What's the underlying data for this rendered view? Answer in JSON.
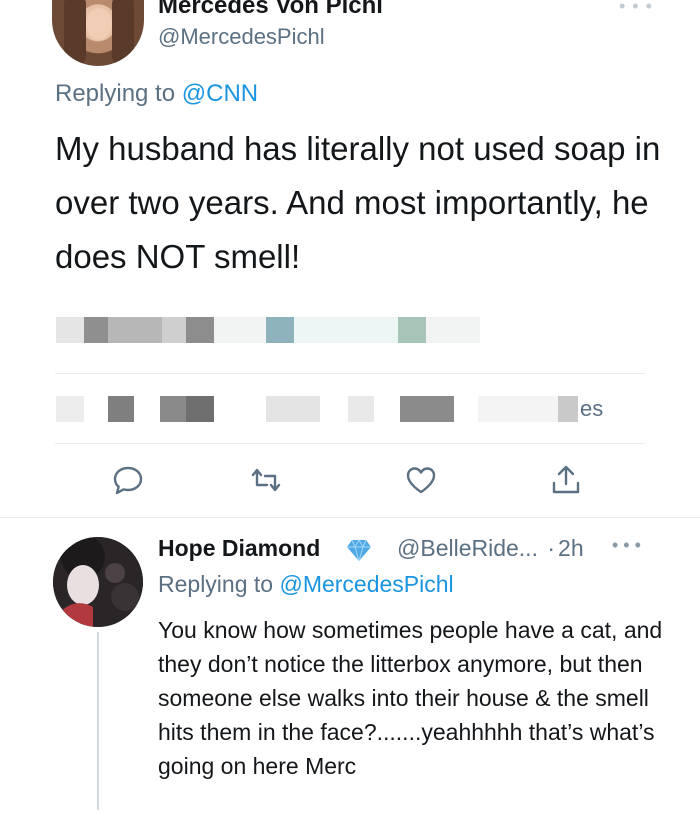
{
  "main_tweet": {
    "display_name": "Mercedes Von Pichl",
    "handle": "@MercedesPichl",
    "replying_prefix": "Replying to",
    "replying_to": "@CNN",
    "text": "My husband has literally not used soap in over two years. And most importantly, he does NOT smell!",
    "stats_fragment": "es",
    "more_icon": "ellipsis-icon"
  },
  "actions": {
    "icons": [
      "reply-icon",
      "retweet-icon",
      "like-icon",
      "share-icon"
    ]
  },
  "reply_tweet": {
    "display_name": "Hope Diamond",
    "badge_icon": "diamond-icon",
    "handle": "@BelleRide...",
    "separator": "·",
    "time": "2h",
    "replying_prefix": "Replying to",
    "replying_to": "@MercedesPichl",
    "text": "You know how sometimes people have a cat, and they don’t notice the litterbox anymore, but then someone else walks into their house & the smell hits them in the face?.......yeahhhhh that’s what’s going on here Merc"
  },
  "colors": {
    "link": "#1b95e0",
    "secondary_text": "#5b7083",
    "divider": "#e6ecf0",
    "badge": "#4fa9e6"
  }
}
